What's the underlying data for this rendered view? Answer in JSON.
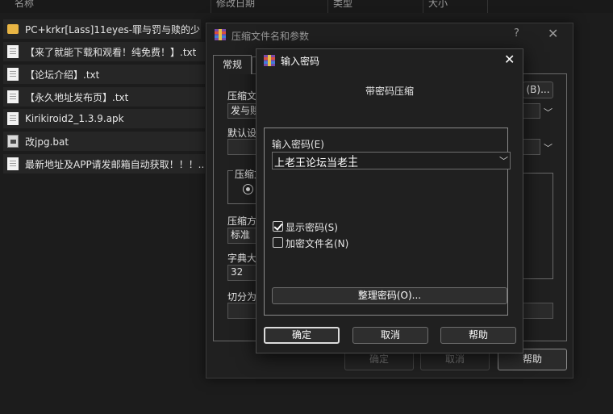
{
  "explorer": {
    "columns": [
      "名称",
      "修改日期",
      "类型",
      "大小"
    ],
    "files": [
      {
        "name": "PC+krkr[Lass]11eyes-罪与罚与赎的少...",
        "icon": "folder-icon"
      },
      {
        "name": "【来了就能下载和观看！纯免费！】.txt",
        "icon": "text-file-icon"
      },
      {
        "name": "【论坛介绍】.txt",
        "icon": "text-file-icon"
      },
      {
        "name": "【永久地址发布页】.txt",
        "icon": "text-file-icon"
      },
      {
        "name": "Kirikiroid2_1.3.9.apk",
        "icon": "file-icon"
      },
      {
        "name": "改jpg.bat",
        "icon": "batch-file-icon"
      },
      {
        "name": "最新地址及APP请发邮箱自动获取！！！...",
        "icon": "text-file-icon"
      }
    ]
  },
  "params_dialog": {
    "title": "压缩文件名和参数",
    "help_glyph": "?",
    "close_glyph": "✕",
    "tab_general": "常规",
    "archive_name_label": "压缩文",
    "browse_button": "(B)...",
    "archive_name_value": "发与赎",
    "default_settings_label": "默认设",
    "format_group_label": "压缩文",
    "method_label": "压缩方",
    "method_value": "标准",
    "dict_label": "字典大",
    "dict_value": "32",
    "split_label": "切分为",
    "ok_button": "确定",
    "cancel_button": "取消",
    "help_button": "帮助"
  },
  "password_dialog": {
    "title": "输入密码",
    "close_glyph": "✕",
    "heading": "带密码压缩",
    "password_label": "输入密码(E)",
    "password_value": "上老王论坛当老王",
    "show_password_label": "显示密码(S)",
    "show_password_checked": true,
    "encrypt_names_label": "加密文件名(N)",
    "encrypt_names_checked": false,
    "organize_button": "整理密码(O)...",
    "ok_button": "确定",
    "cancel_button": "取消",
    "help_button": "帮助"
  }
}
